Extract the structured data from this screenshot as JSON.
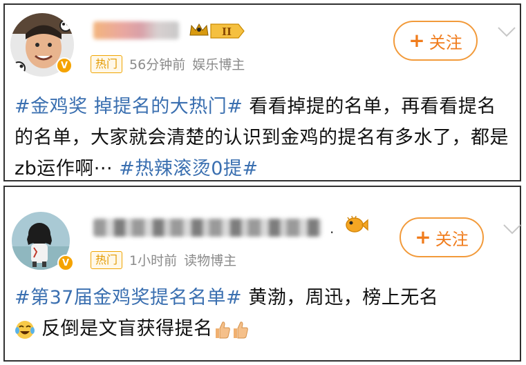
{
  "posts": [
    {
      "time": "56分钟前",
      "role": "娱乐博主",
      "hot_tag": "热门",
      "follow_label": "关注",
      "level_badge": "II",
      "content": {
        "hashtag_lead": "#金鸡奖 掉提名的大热门#",
        "body": " 看看掉提的名单，再看看提名的名单，大家就会清楚的认识到金鸡的提名有多水了，都是zb运作啊··· ",
        "hashtag_tail": "#热辣滚烫0提#"
      }
    },
    {
      "time": "1小时前",
      "role": "读物博主",
      "hot_tag": "热门",
      "follow_label": "关注",
      "name_suffix": ".",
      "content": {
        "hashtag_lead": "#第37届金鸡奖提名名单#",
        "body": " 黄渤，周迅，榜上无名",
        "body2": "反倒是文盲获得提名"
      }
    }
  ],
  "colors": {
    "hashtag": "#3a6fb0",
    "follow": "#f07c1c",
    "hot_border": "#f0a400",
    "verified": "#f5a300"
  }
}
